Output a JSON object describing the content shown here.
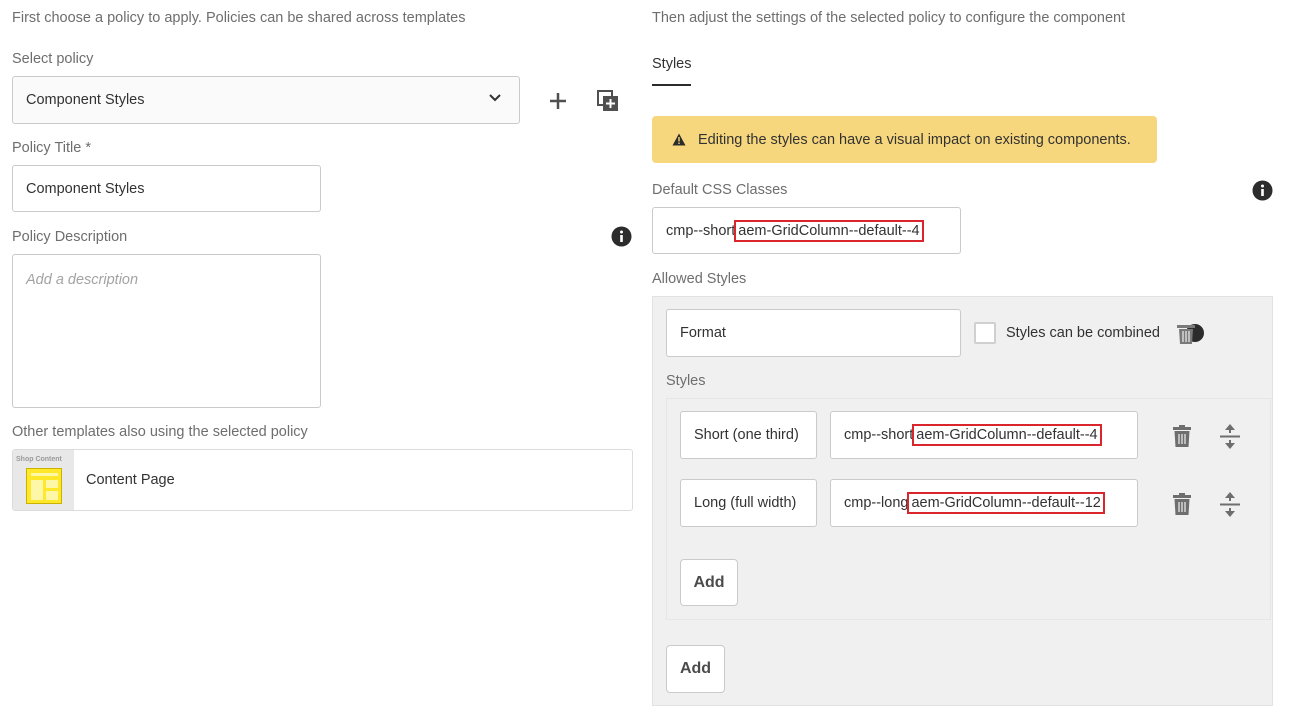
{
  "left": {
    "intro": "First choose a policy to apply. Policies can be shared across templates",
    "select_policy_label": "Select policy",
    "select_policy_value": "Component Styles",
    "policy_title_label": "Policy Title *",
    "policy_title_value": "Component Styles",
    "policy_description_label": "Policy Description",
    "policy_description_placeholder": "Add a description",
    "other_templates_label": "Other templates also using the selected policy",
    "template_thumb_text": "Shop Content",
    "template_name": "Content Page"
  },
  "right": {
    "intro": "Then adjust the settings of the selected policy to configure the component",
    "tab_styles": "Styles",
    "warning_text": "Editing the styles can have a visual impact on existing components.",
    "default_css_label": "Default CSS Classes",
    "default_css_prefix": "cmp--short",
    "default_css_highlight": "aem-GridColumn--default--4",
    "allowed_styles_label": "Allowed Styles",
    "group_name": "Format",
    "combine_label": "Styles can be combined",
    "styles_label": "Styles",
    "styles": [
      {
        "name": "Short (one third)",
        "class_prefix": "cmp--short",
        "class_highlight": "aem-GridColumn--default--4"
      },
      {
        "name": "Long (full width)",
        "class_prefix": "cmp--long",
        "class_highlight": "aem-GridColumn--default--12"
      }
    ],
    "add_style_label": "Add",
    "add_group_label": "Add"
  },
  "colors": {
    "warning_bg": "#f7d77e",
    "highlight_border": "#d9262c",
    "panel_bg": "#f0f0f0",
    "tab_underline": "#2c2c2c"
  }
}
